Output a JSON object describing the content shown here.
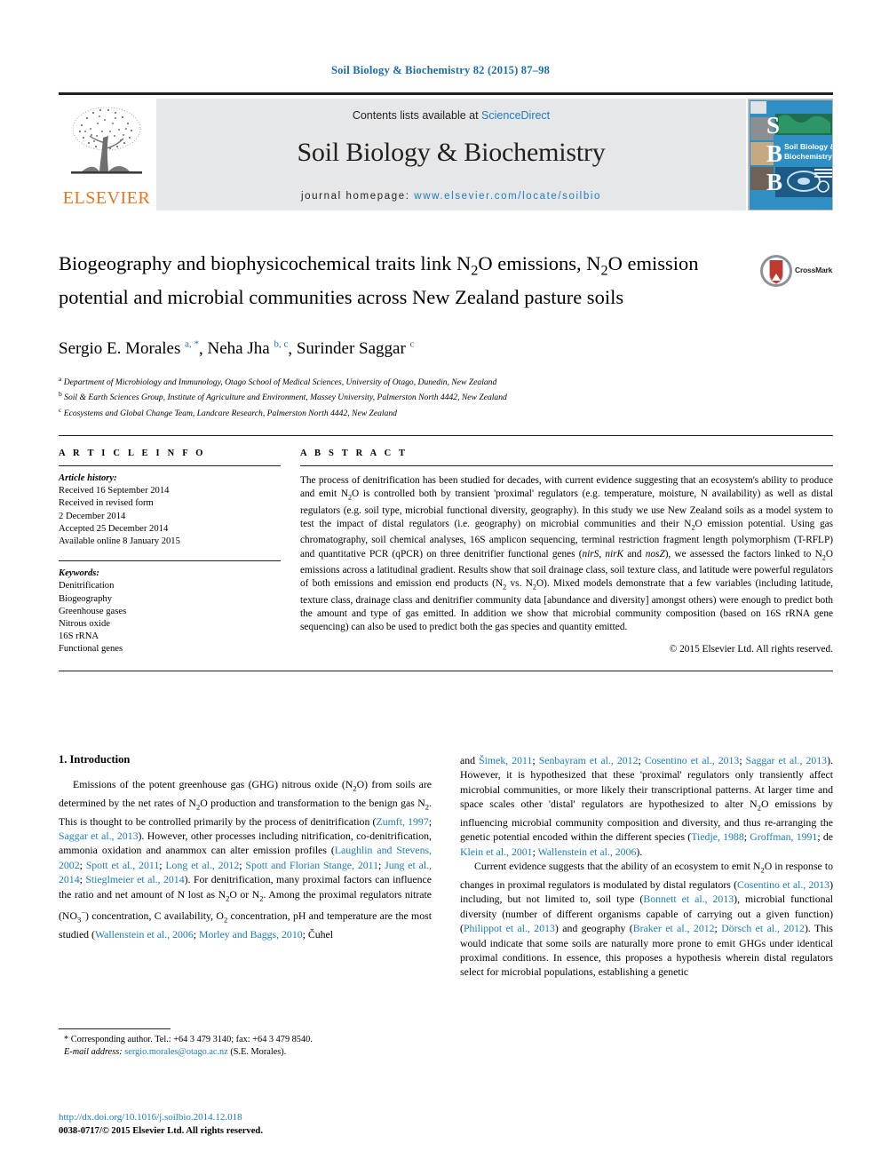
{
  "running_head": "Soil Biology & Biochemistry 82 (2015) 87–98",
  "masthead": {
    "contents_prefix": "Contents lists available at ",
    "contents_link": "ScienceDirect",
    "journal_title": "Soil Biology & Biochemistry",
    "homepage_prefix": "journal homepage: ",
    "homepage_url": "www.elsevier.com/locate/soilbio",
    "elsevier_wordmark": "ELSEVIER",
    "cover_letters": [
      "S",
      "B",
      "B"
    ],
    "cover_title_line1": "Soil Biology &",
    "cover_title_line2": "Biochemistry"
  },
  "crossmark": {
    "label": "CrossMark"
  },
  "article": {
    "title_part1": "Biogeography and biophysicochemical traits link N",
    "title_sub1": "2",
    "title_part2": "O emissions, N",
    "title_sub2": "2",
    "title_part3": "O emission potential and microbial communities across New Zealand pasture soils",
    "title_plain": "Biogeography and biophysicochemical traits link N2O emissions, N2O emission potential and microbial communities across New Zealand pasture soils",
    "authors_plain": "Sergio E. Morales a, *, Neha Jha b, c, Surinder Saggar c",
    "authors": [
      {
        "name": "Sergio E. Morales",
        "marks": "a, *"
      },
      {
        "name": "Neha Jha",
        "marks": "b, c"
      },
      {
        "name": "Surinder Saggar",
        "marks": "c"
      }
    ],
    "affiliations": [
      {
        "mark": "a",
        "text": "Department of Microbiology and Immunology, Otago School of Medical Sciences, University of Otago, Dunedin, New Zealand"
      },
      {
        "mark": "b",
        "text": "Soil & Earth Sciences Group, Institute of Agriculture and Environment, Massey University, Palmerston North 4442, New Zealand"
      },
      {
        "mark": "c",
        "text": "Ecosystems and Global Change Team, Landcare Research, Palmerston North 4442, New Zealand"
      }
    ]
  },
  "article_info": {
    "heading": "A R T I C L E  I N F O",
    "history_label": "Article history:",
    "history_lines": [
      "Received 16 September 2014",
      "Received in revised form",
      "2 December 2014",
      "Accepted 25 December 2014",
      "Available online 8 January 2015"
    ],
    "keywords_label": "Keywords:",
    "keywords": [
      "Denitrification",
      "Biogeography",
      "Greenhouse gases",
      "Nitrous oxide",
      "16S rRNA",
      "Functional genes"
    ]
  },
  "abstract": {
    "heading": "A B S T R A C T",
    "text": "The process of denitrification has been studied for decades, with current evidence suggesting that an ecosystem's ability to produce and emit N2O is controlled both by transient 'proximal' regulators (e.g. temperature, moisture, N availability) as well as distal regulators (e.g. soil type, microbial functional diversity, geography). In this study we use New Zealand soils as a model system to test the impact of distal regulators (i.e. geography) on microbial communities and their N2O emission potential. Using gas chromatography, soil chemical analyses, 16S amplicon sequencing, terminal restriction fragment length polymorphism (T-RFLP) and quantitative PCR (qPCR) on three denitrifier functional genes (nirS, nirK and nosZ), we assessed the factors linked to N2O emissions across a latitudinal gradient. Results show that soil drainage class, soil texture class, and latitude were powerful regulators of both emissions and emission end products (N2 vs. N2O). Mixed models demonstrate that a few variables (including latitude, texture class, drainage class and denitrifier community data [abundance and diversity] amongst others) were enough to predict both the amount and type of gas emitted. In addition we show that microbial community composition (based on 16S rRNA gene sequencing) can also be used to predict both the gas species and quantity emitted.",
    "copyright": "© 2015 Elsevier Ltd. All rights reserved."
  },
  "body": {
    "section_number_title": "1. Introduction",
    "left_para_1": "Emissions of the potent greenhouse gas (GHG) nitrous oxide (N2O) from soils are determined by the net rates of N2O production and transformation to the benign gas N2. This is thought to be controlled primarily by the process of denitrification (Zumft, 1997; Saggar et al., 2013). However, other processes including nitrification, co-denitrification, ammonia oxidation and anammox can alter emission profiles (Laughlin and Stevens, 2002; Spott et al., 2011; Long et al., 2012; Spott and Florian Stange, 2011; Jung et al., 2014; Stieglmeier et al., 2014). For denitrification, many proximal factors can influence the ratio and net amount of N lost as N2O or N2. Among the proximal regulators nitrate (NO3-) concentration, C availability, O2 concentration, pH and temperature are the most studied (Wallenstein et al., 2006; Morley and Baggs, 2010; Čuhel",
    "right_para_1": "and Šimek, 2011; Senbayram et al., 2012; Cosentino et al., 2013; Saggar et al., 2013). However, it is hypothesized that these 'proximal' regulators only transiently affect microbial communities, or more likely their transcriptional patterns. At larger time and space scales other 'distal' regulators are hypothesized to alter N2O emissions by influencing microbial community composition and diversity, and thus re-arranging the genetic potential encoded within the different species (Tiedje, 1988; Groffman, 1991; de Klein et al., 2001; Wallenstein et al., 2006).",
    "right_para_2": "Current evidence suggests that the ability of an ecosystem to emit N2O in response to changes in proximal regulators is modulated by distal regulators (Cosentino et al., 2013) including, but not limited to, soil type (Bonnett et al., 2013), microbial functional diversity (number of different organisms capable of carrying out a given function) (Philippot et al., 2013) and geography (Braker et al., 2012; Dörsch et al., 2012). This would indicate that some soils are naturally more prone to emit GHGs under identical proximal conditions. In essence, this proposes a hypothesis wherein distal regulators select for microbial populations, establishing a genetic"
  },
  "footnotes": {
    "corresponding": "* Corresponding author. Tel.: +64 3 479 3140; fax: +64 3 479 8540.",
    "email_label": "E-mail address:",
    "email": "sergio.morales@otago.ac.nz",
    "email_suffix": "(S.E. Morales).",
    "doi": "http://dx.doi.org/10.1016/j.soilbio.2014.12.018",
    "issn_line": "0038-0717/© 2015 Elsevier Ltd. All rights reserved."
  },
  "colors": {
    "link_blue": "#1a7cb8",
    "header_blue": "#1a6ca8",
    "elsevier_orange": "#e87722",
    "masthead_gray": "#e6e7e8",
    "cover_blue": "#2e8fc4"
  }
}
